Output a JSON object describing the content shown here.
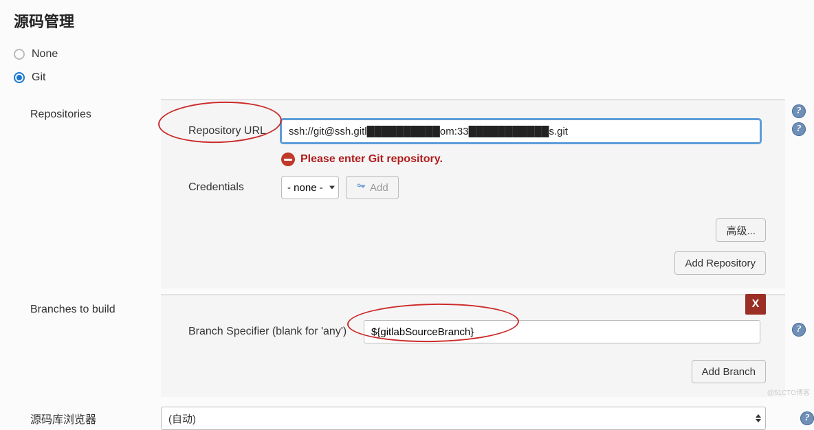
{
  "section_title": "源码管理",
  "scm": {
    "none_label": "None",
    "git_label": "Git",
    "selected": "git"
  },
  "repositories": {
    "section_label": "Repositories",
    "url_label": "Repository URL",
    "url_value": "ssh://git@ssh.gitl██████████om:33███████████s.git",
    "error_msg": "Please enter Git repository.",
    "credentials_label": "Credentials",
    "credentials_value": "- none -",
    "add_label": "Add",
    "advanced_label": "高级...",
    "add_repo_label": "Add Repository"
  },
  "branches": {
    "section_label": "Branches to build",
    "specifier_label": "Branch Specifier (blank for 'any')",
    "specifier_value": "${gitlabSourceBranch}",
    "delete_label": "X",
    "add_branch_label": "Add Branch"
  },
  "browser": {
    "label": "源码库浏览器",
    "value": "(自动)"
  },
  "watermark": "@51CTO博客"
}
